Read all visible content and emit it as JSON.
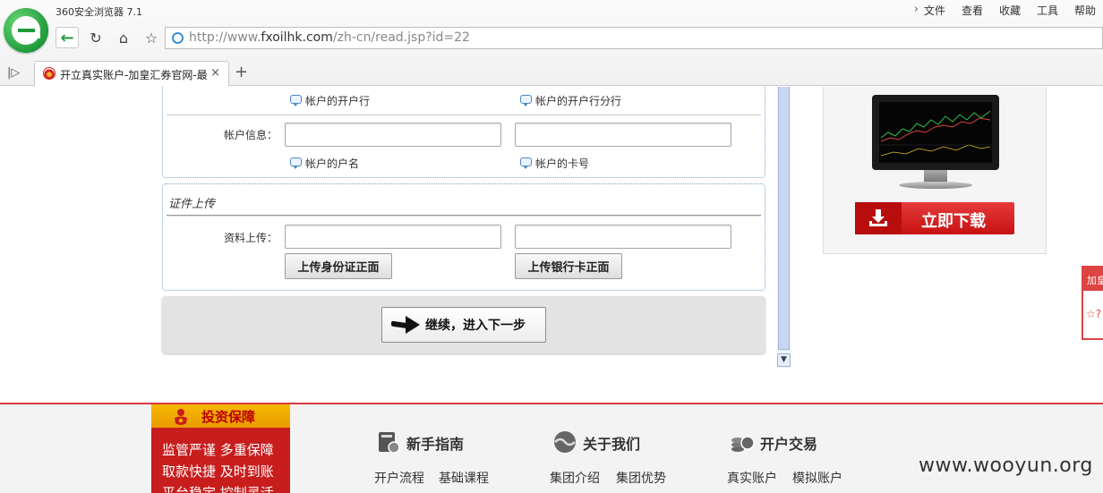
{
  "browser": {
    "app_title": "360安全浏览器 7.1",
    "menu": [
      "文件",
      "查看",
      "收藏",
      "工具",
      "帮助"
    ],
    "url_prefix": "http://www.",
    "url_host": "fxoilhk.com",
    "url_path": "/zh-cn/read.jsp?id=22",
    "tab_title": "开立真实账户-加皇汇券官网-最",
    "new_tab": "+",
    "close": "×"
  },
  "form": {
    "bank_hints": [
      "帐户的开户行",
      "帐户的开户行分行"
    ],
    "account_label": "帐户信息：",
    "account_hints": [
      "帐户的户名",
      "帐户的卡号"
    ],
    "upload_legend": "证件上传",
    "upload_label": "资料上传：",
    "upload_id_btn": "上传身份证正面",
    "upload_card_btn": "上传银行卡正面",
    "next_btn": "继续，进入下一步"
  },
  "ad": {
    "download_label": "立即下载"
  },
  "float_tab": {
    "head": "加皇",
    "star_text": "☆?"
  },
  "footer": {
    "invest_title": "投资保障",
    "invest_lines": [
      "监管严谨  多重保障",
      "取款快捷  及时到账",
      "平台稳定  控制灵活"
    ],
    "columns": [
      {
        "title": "新手指南",
        "links": [
          "开户流程",
          "基础课程"
        ]
      },
      {
        "title": "关于我们",
        "links": [
          "集团介绍",
          "集团优势"
        ]
      },
      {
        "title": "开户交易",
        "links": [
          "真实账户",
          "模拟账户"
        ]
      }
    ],
    "watermark": "www.wooyun.org"
  },
  "colors": {
    "accent_red": "#c81d1d",
    "accent_gold": "#f6b800",
    "link_blue": "#4c88c7"
  }
}
